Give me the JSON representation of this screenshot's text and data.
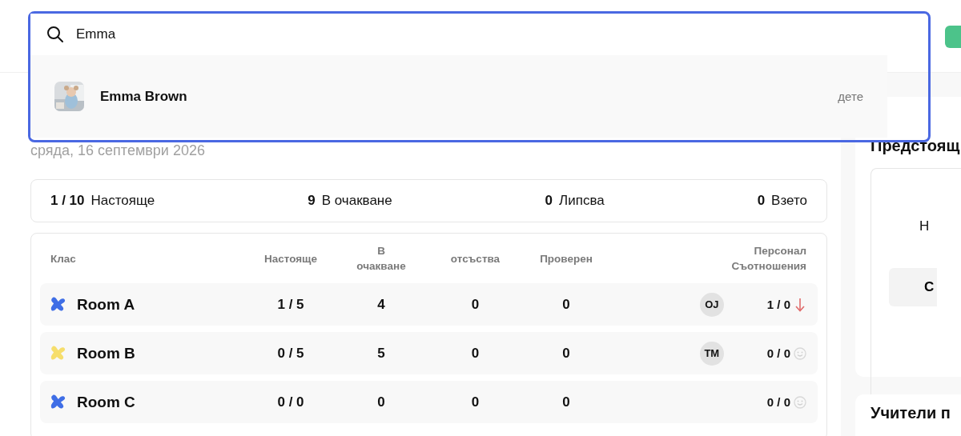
{
  "search": {
    "value": "Emma",
    "results": [
      {
        "name": "Emma Brown",
        "type": "дете"
      }
    ]
  },
  "date": "сряда, 16 септември 2026",
  "summary": [
    {
      "count": "1 / 10",
      "label": "Настояще"
    },
    {
      "count": "9",
      "label": "В очакване"
    },
    {
      "count": "0",
      "label": "Липсва"
    },
    {
      "count": "0",
      "label": "Взето"
    }
  ],
  "table": {
    "columns": [
      {
        "label": "Клас"
      },
      {
        "label": "Настояще"
      },
      {
        "label": "В очакване"
      },
      {
        "label": "отсъства"
      },
      {
        "label": "Проверен"
      },
      {
        "label": "Персонал Съотношения"
      }
    ],
    "rows": [
      {
        "name": "Room A",
        "color": "#3f6ee6",
        "present": "1 / 5",
        "pending": "4",
        "absent": "0",
        "checked": "0",
        "staff": "OJ",
        "ratio": "1 / 0",
        "ratio_low": true
      },
      {
        "name": "Room B",
        "color": "#f6de6c",
        "present": "0 / 5",
        "pending": "5",
        "absent": "0",
        "checked": "0",
        "staff": "TM",
        "ratio": "0 / 0",
        "ratio_low": false
      },
      {
        "name": "Room C",
        "color": "#3f6ee6",
        "present": "0 / 0",
        "pending": "0",
        "absent": "0",
        "checked": "0",
        "ratio": "0 / 0",
        "ratio_low": false
      }
    ]
  },
  "aside": {
    "heading": "Предстоящ",
    "note": "Н",
    "button": "С",
    "next_heading": "Учители п"
  }
}
